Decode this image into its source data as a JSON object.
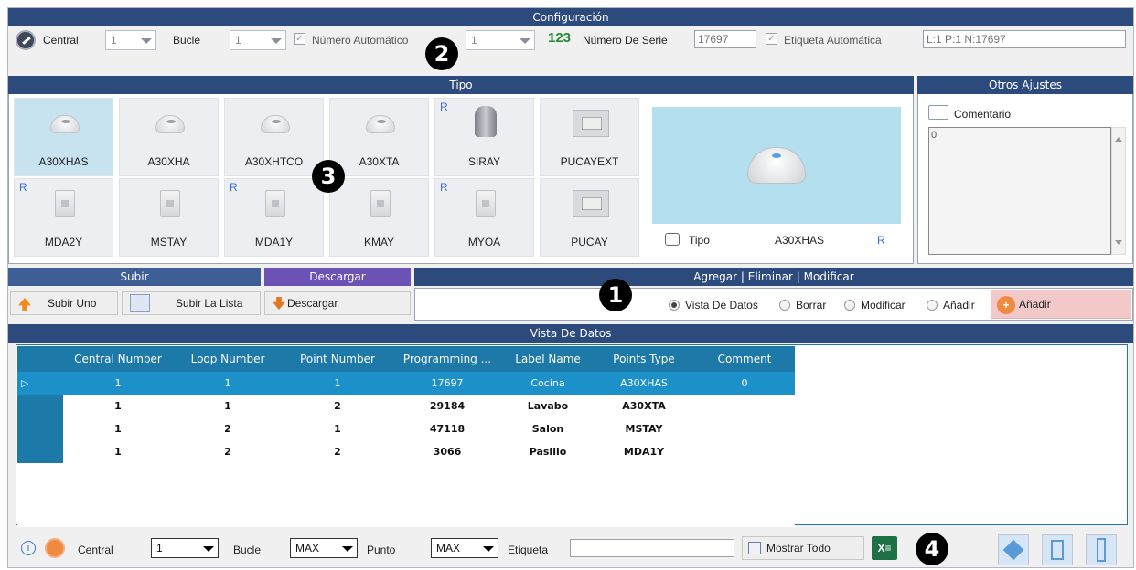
{
  "config": {
    "header": "Configuración",
    "central_label": "Central",
    "central_value": "1",
    "bucle_label": "Bucle",
    "bucle_value": "1",
    "auto_number_label": "Número Automático",
    "auto_number_value": "1",
    "serial_label": "Número De Serie",
    "serial_icon": "123",
    "serial_value": "17697",
    "auto_label_label": "Etiqueta Automática",
    "label_value": "L:1 P:1 N:17697"
  },
  "tipo": {
    "header": "Tipo",
    "tiles": [
      {
        "name": "A30XHAS",
        "r": "",
        "icon": "smoke-detector-icon",
        "selected": true
      },
      {
        "name": "A30XHA",
        "r": "",
        "icon": "heat-detector-icon"
      },
      {
        "name": "A30XHTCO",
        "r": "",
        "icon": "multi-detector-icon"
      },
      {
        "name": "A30XTA",
        "r": "",
        "icon": "heat-detector-icon"
      },
      {
        "name": "SIRAY",
        "r": "R",
        "icon": "siren-icon"
      },
      {
        "name": "PUCAYEXT",
        "r": "",
        "icon": "panel-icon"
      },
      {
        "name": "MDA2Y",
        "r": "R",
        "icon": "module-icon"
      },
      {
        "name": "MSTAY",
        "r": "",
        "icon": "module-icon"
      },
      {
        "name": "MDA1Y",
        "r": "R",
        "icon": "module-icon"
      },
      {
        "name": "KMAY",
        "r": "",
        "icon": "module-icon"
      },
      {
        "name": "MYOA",
        "r": "R",
        "icon": "module-icon"
      },
      {
        "name": "PUCAY",
        "r": "",
        "icon": "panel-icon"
      }
    ],
    "preview_type_label": "Tipo",
    "preview_type_value": "A30XHAS",
    "preview_r": "R"
  },
  "otros": {
    "header": "Otros Ajustes",
    "comment_label": "Comentario",
    "comment_value": "0"
  },
  "subir": {
    "header": "Subir",
    "upload_one": "Subir Uno",
    "upload_list": "Subir La Lista"
  },
  "descargar": {
    "header": "Descargar",
    "download": "Descargar"
  },
  "modify": {
    "header": "Agregar | Eliminar | Modificar",
    "options": [
      "Vista De Datos",
      "Borrar",
      "Modificar",
      "Añadir"
    ],
    "selected": "Vista De Datos",
    "add_button": "Añadir"
  },
  "data_view": {
    "header": "Vista De Datos",
    "columns": [
      "Central Number",
      "Loop Number",
      "Point Number",
      "Programming ...",
      "Label Name",
      "Points Type",
      "Comment"
    ],
    "rows": [
      [
        "1",
        "1",
        "1",
        "17697",
        "Cocina",
        "A30XHAS",
        "0"
      ],
      [
        "1",
        "1",
        "2",
        "29184",
        "Lavabo",
        "A30XTA",
        ""
      ],
      [
        "1",
        "2",
        "1",
        "47118",
        "Salon",
        "MSTAY",
        ""
      ],
      [
        "1",
        "2",
        "2",
        "3066",
        "Pasillo",
        "MDA1Y",
        ""
      ]
    ]
  },
  "filter": {
    "central_label": "Central",
    "central_value": "1",
    "bucle_label": "Bucle",
    "bucle_value": "MAX",
    "punto_label": "Punto",
    "punto_value": "MAX",
    "etiqueta_label": "Etiqueta",
    "etiqueta_value": "",
    "show_all": "Mostrar Todo"
  },
  "badges": [
    "1",
    "2",
    "3",
    "4"
  ],
  "colors": {
    "header_navy": "#2d4a7c",
    "header_purple": "#6c52b4",
    "grid_blue": "#1c79a8",
    "selected_row": "#1c90c8",
    "tile_selected": "#c6e3ef",
    "preview_bg": "#b4dfee",
    "add_button_bg": "#f2c8c8"
  }
}
